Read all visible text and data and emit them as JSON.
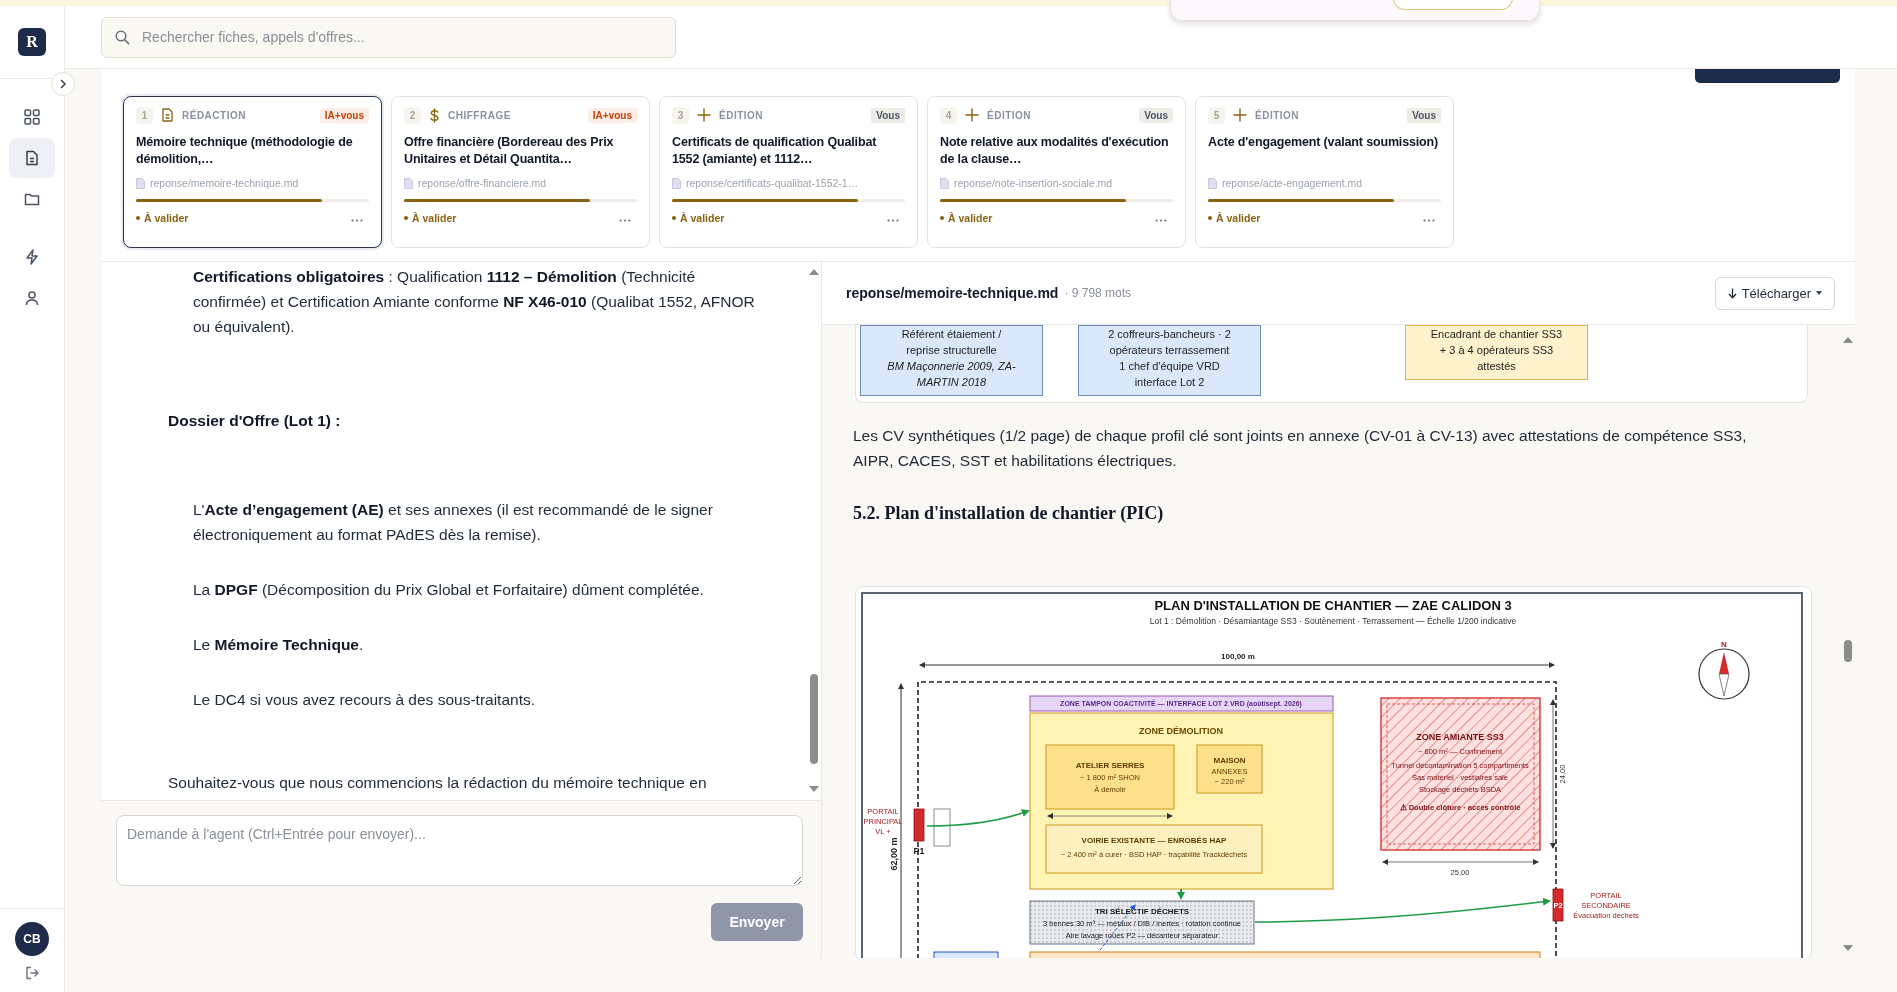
{
  "sidebar": {
    "logo": "R",
    "groups": [
      [
        {
          "kind": "grid",
          "selected": false
        },
        {
          "kind": "document",
          "selected": true
        },
        {
          "kind": "folder",
          "selected": false
        }
      ],
      [
        {
          "kind": "bolt",
          "selected": false
        },
        {
          "kind": "user",
          "selected": false
        }
      ]
    ],
    "avatar": "CB"
  },
  "search": {
    "placeholder": "Rechercher fiches, appels d'offres..."
  },
  "roadmap": {
    "cards": [
      {
        "number": "1",
        "kind": "document",
        "category": "RÉDACTION",
        "tag": "IA+vous",
        "title": "Mémoire technique (méthodologie de démolition,…",
        "file": "reponse/memoire-technique.md",
        "level": 0.8,
        "status": "À valider",
        "selected": true
      },
      {
        "number": "2",
        "kind": "dollar",
        "category": "CHIFFRAGE",
        "tag": "IA+vous",
        "title": "Offre financière (Bordereau des Prix Unitaires et Détail Quantita…",
        "file": "reponse/offre-financiere.md",
        "level": 0.8,
        "status": "À valider",
        "selected": false
      },
      {
        "number": "3",
        "kind": "plus",
        "category": "ÉDITION",
        "tag": "Vous",
        "title": "Certificats de qualification Qualibat 1552 (amiante) et 1112…",
        "file": "reponse/certificats-qualibat-1552-1…",
        "level": 0.8,
        "status": "À valider",
        "selected": false
      },
      {
        "number": "4",
        "kind": "plus",
        "category": "ÉDITION",
        "tag": "Vous",
        "title": "Note relative aux modalités d'exécution de la clause…",
        "file": "reponse/note-insertion-sociale.md",
        "level": 0.8,
        "status": "À valider",
        "selected": false
      },
      {
        "number": "5",
        "kind": "plus",
        "category": "ÉDITION",
        "tag": "Vous",
        "title": "Acte d'engagement (valant soumission)",
        "file": "reponse/acte-engagement.md",
        "level": 0.8,
        "status": "À valider",
        "selected": false
      }
    ]
  },
  "chat": {
    "blocks": [
      {
        "kind": "item",
        "text": "**Certifications obligatoires** : Qualification **1112 – Démolition** (Technicité confirmée) et Certification Amiante conforme **NF X46-010** (Qualibat 1552, AFNOR ou équivalent)."
      },
      {
        "kind": "heading",
        "text": "Dossier d'Offre (Lot 1) :"
      },
      {
        "kind": "item",
        "text": "L'**Acte d’engagement (AE)** et ses annexes (il est recommandé de le signer électroniquement au format PAdES dès la remise)."
      },
      {
        "kind": "item",
        "text": "La **DPGF** (Décomposition du Prix Global et Forfaitaire) dûment complétée."
      },
      {
        "kind": "item",
        "text": "Le **Mémoire Technique**."
      },
      {
        "kind": "item",
        "text": "Le DC4 si vous avez recours à des sous-traitants."
      },
      {
        "kind": "para",
        "text": "Souhaitez-vous que nous commencions la rédaction du mémoire technique en"
      }
    ],
    "input": {
      "placeholder": "Demande à l'agent (Ctrl+Entrée pour envoyer)..."
    },
    "send": "Envoyer"
  },
  "document": {
    "file": "reponse/memoire-technique.md",
    "words": "· 9 798 mots",
    "download": "Télécharger",
    "org_boxes": [
      {
        "color": "#dae8fc",
        "lines": [
          "Référent étaiement /",
          "reprise structurelle",
          "*BM Maçonnerie 2009, ZA-*",
          "*MARTIN 2018*"
        ]
      },
      {
        "color": "#dae8fc",
        "lines": [
          "2 coffreurs-bancheurs · 2",
          "opérateurs terrassement",
          "1 chef d'équipe VRD",
          "interface Lot 2"
        ]
      },
      {
        "color": "#fff2cc",
        "lines": [
          "Encadrant de chantier SS3",
          "+ 3 à 4 opérateurs SS3",
          "attestés"
        ]
      }
    ],
    "paragraph": "Les CV synthétiques (1/2 page) de chaque profil clé sont joints en annexe (CV-01 à CV-13) avec attestations de compétence SS3, AIPR, CACES, SST et habilitations électriques.",
    "heading": "5.2. Plan d'installation de chantier (PIC)",
    "plan": {
      "title": "PLAN D'INSTALLATION DE CHANTIER — ZAE CALIDON 3",
      "subtitle": "Lot 1 : Démolition · Désamiantage SS3 · Soutènement · Terrassement — Échelle 1/200 indicative",
      "width_label": "100,00 m",
      "height_label": "62,00 m",
      "compass": "N",
      "buffer_zone": "ZONE TAMPON COACTIVITÉ — INTERFACE LOT 2 VRD (août/sept. 2026)",
      "demolition_zone": {
        "title": "ZONE DÉMOLITION",
        "buildings": [
          {
            "lines": [
              "ATELIER SERRES",
              "~ 1 800 m² SHON",
              "À démolir"
            ]
          },
          {
            "lines": [
              "MAISON",
              "ANNEXES",
              "~ 220 m²"
            ]
          }
        ],
        "road": [
          "VOIRIE EXISTANTE — ENROBÉS HAP",
          "~ 2 400 m² à curer · BSD HAP · traçabilité Trackdéchets"
        ]
      },
      "asbestos_zone": {
        "lines": [
          "ZONE AMIANTE SS3",
          "~ 600 m² — Confinement",
          "Tunnel décontamination 5 compartiments",
          "Sas matériel · vestiaires sale",
          "Stockage déchets BSDA",
          "⚠ Double clôture · accès contrôlé"
        ],
        "width_label": "25,00",
        "height_label": "24,00"
      },
      "sorting_area": [
        "TRI SÉLECTIF DÉCHETS",
        "3 bennes 30 m³ — métaux / DIB / inertes · rotation continue",
        "Aire lavage roues P2 — décanteur séparateur"
      ],
      "gates": [
        {
          "code": "P1",
          "lines": [
            "PORTAIL",
            "PRINCIPAL",
            "VL +"
          ]
        },
        {
          "code": "P2",
          "lines": [
            "PORTAIL",
            "SECONDAIRE",
            "Évacuation déchets"
          ]
        }
      ]
    }
  }
}
